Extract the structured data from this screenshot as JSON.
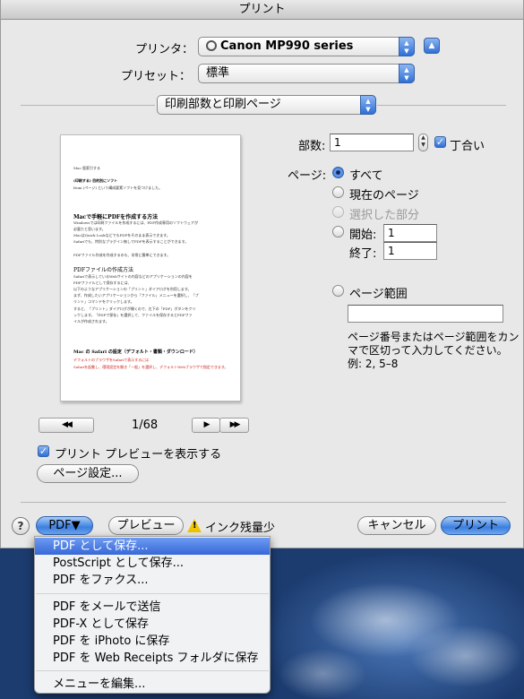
{
  "window": {
    "title": "プリント"
  },
  "printer": {
    "label": "プリンタ：",
    "value": "Canon MP990 series",
    "expand_glyph": "▲"
  },
  "preset": {
    "label": "プリセット：",
    "value": "標準"
  },
  "section": {
    "value": "印刷部数と印刷ページ"
  },
  "preview": {
    "lines": {
      "l1": "Mac 版索引する",
      "l2": "(印刷する) 目的別にソフト",
      "l3": "from (ページ) という構成要素ソフトを見つけました。",
      "h1": "Macで手軽にPDFを作成する方法",
      "b1": "Windowsでは印刷ファイルを作成するには、PDF作成専用のソフトウェアが",
      "b2": "必要だと思います。",
      "b3": "MacはQuick LookなどでもPDFをそのまま表示できます。",
      "b4": "Safariでも、特別なプラグイン無しでPDFを表示することができます。",
      "b5": "PDFファイル作成を作成するのも、非常に簡単にできます。",
      "h2": "PDFファイルの作成方法",
      "c1": "Safariで表示しているWebサイトの内容などのアプリケーションの内容を",
      "c2": "PDFファイルとして保存するには、",
      "c3": "以下のようなアプリケーションの「プリント」ダイアログを利用します。",
      "c4": "まず、作成したいアプリケーションから「ファイル」メニューを選択し、「プ",
      "c5": "リント」コマンドをクリックします。",
      "c6": "すると、「プリント」ダイアログが開くので、左下の「PDF」ボタンをクリ",
      "c7": "ックします。「PDFで保存」を選択して、ファイルを保存するとPDFファ",
      "c8": "イルが作成されます。",
      "h3": "Mac の Safari の設定（デフォルト・書類・ダウンロード）",
      "r1": "デフォルトのブラウザをSafariで表示するには",
      "r2": "Safariを起動し、環境設定を開き「一般」を選択し、デフォルトWebブラウザで指定できます。"
    },
    "page_indicator": "1/68",
    "first_label": "◀◀",
    "prev_label": "◀",
    "next_label": "▶",
    "last_label": "▶▶"
  },
  "show_preview": {
    "label": "プリント プレビューを表示する",
    "checked": true
  },
  "page_setup_button": "ページ設定...",
  "copies": {
    "label": "部数:",
    "value": "1",
    "collate_label": "丁合い",
    "collate_checked": true
  },
  "pages": {
    "label": "ページ:",
    "all": "すべて",
    "current": "現在のページ",
    "selection": "選択した部分",
    "from_label": "開始:",
    "from_value": "1",
    "to_label": "終了:",
    "to_value": "1",
    "range_label": "ページ範囲",
    "range_value": "",
    "help_line1": "ページ番号またはページ範囲をカン",
    "help_line2": "マで区切って入力してください。",
    "help_line3": "例: 2, 5–8"
  },
  "footer": {
    "help_glyph": "?",
    "pdf_button": "PDF▼",
    "preview_button": "プレビュー",
    "ink_warning": "インク残量少",
    "cancel_button": "キャンセル",
    "print_button": "プリント"
  },
  "pdf_menu": [
    "PDF として保存...",
    "PostScript として保存...",
    "PDF をファクス...",
    "PDF をメールで送信",
    "PDF-X として保存",
    "PDF を iPhoto に保存",
    "PDF を Web Receipts フォルダに保存",
    "メニューを編集..."
  ],
  "colors": {
    "accent": "#3768d8",
    "warning": "#f2c500"
  }
}
